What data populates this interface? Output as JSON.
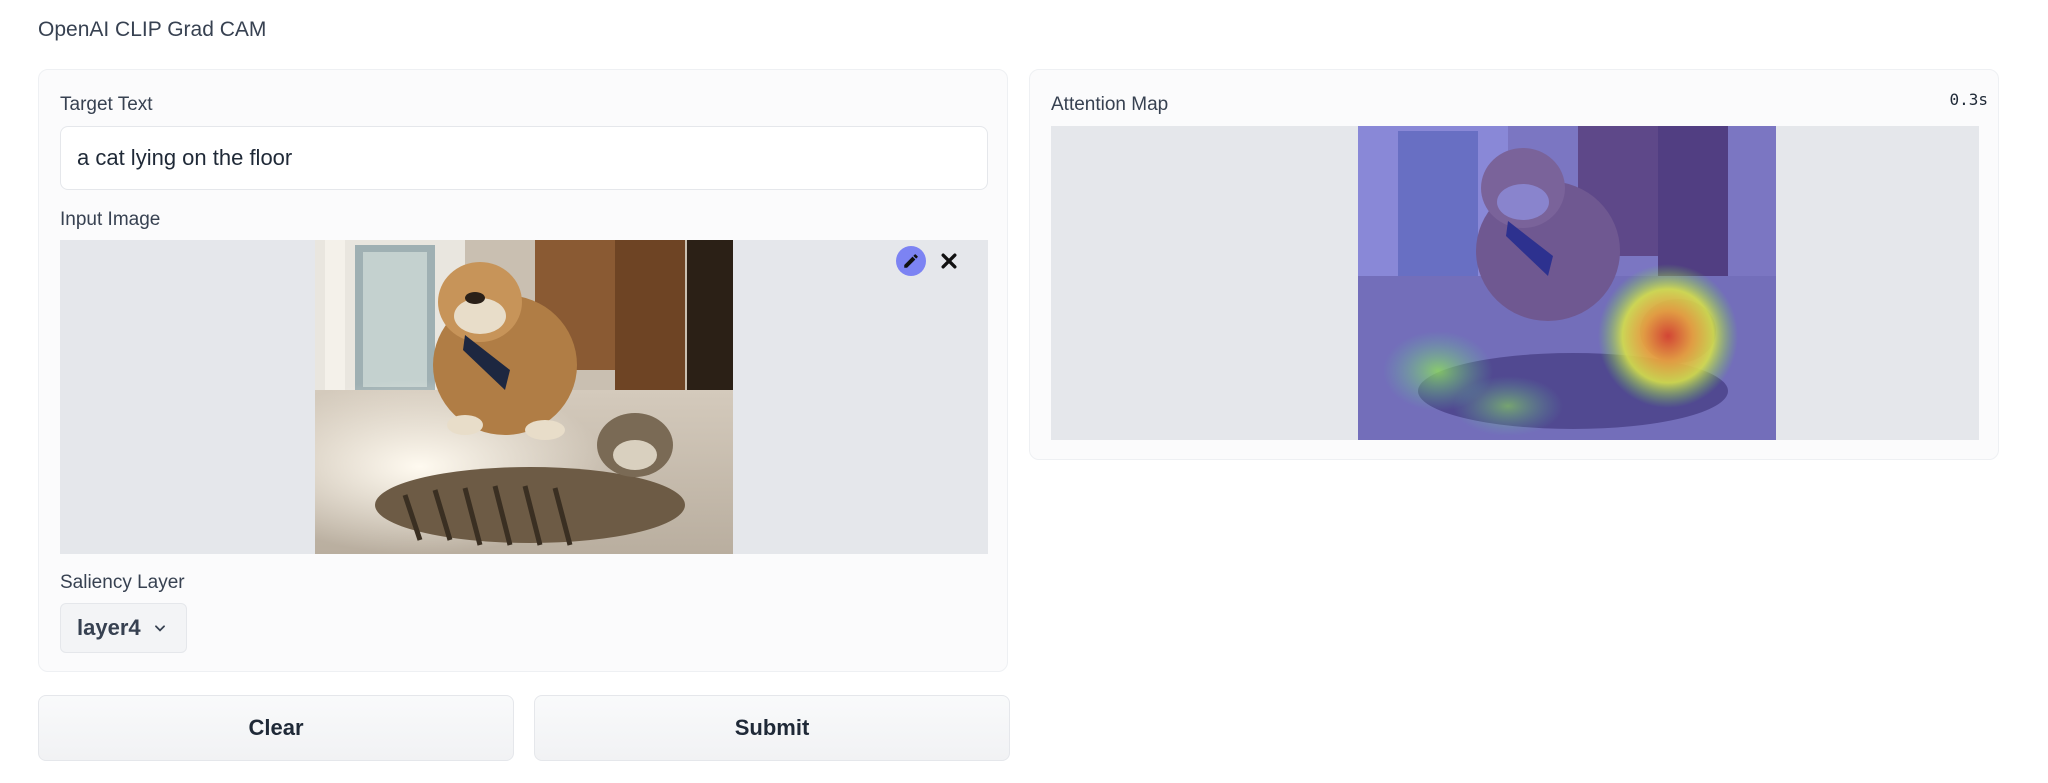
{
  "app": {
    "title": "OpenAI CLIP Grad CAM"
  },
  "inputs": {
    "target_text_label": "Target Text",
    "target_text_value": "a cat lying on the floor",
    "input_image_label": "Input Image",
    "saliency_layer_label": "Saliency Layer",
    "saliency_layer_value": "layer4"
  },
  "output": {
    "attention_map_label": "Attention Map",
    "elapsed": "0.3s"
  },
  "actions": {
    "clear_label": "Clear",
    "submit_label": "Submit"
  },
  "icons": {
    "edit": "pencil-icon",
    "remove": "close-icon",
    "dropdown": "chevron-down-icon"
  },
  "colors": {
    "edit_button_bg": "#7c83f3",
    "heatmap_overlay": "#3a3ad0"
  }
}
